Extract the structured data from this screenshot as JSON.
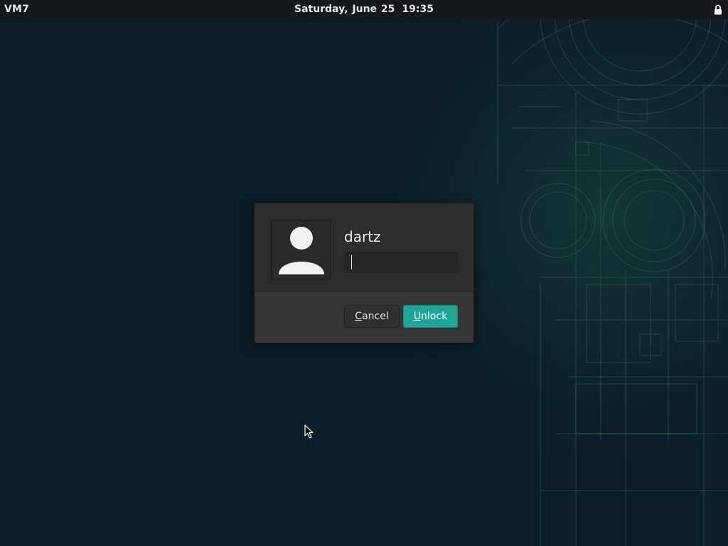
{
  "topbar": {
    "hostname": "VM7",
    "date": "Saturday, June 25",
    "time": "19:35",
    "status_icon": "lock-icon"
  },
  "unlock_dialog": {
    "username": "dartz",
    "avatar_icon": "user-avatar-icon",
    "password_value": "",
    "cancel_button": {
      "mnemonic": "C",
      "rest": "ancel"
    },
    "unlock_button": {
      "mnemonic": "U",
      "rest": "nlock"
    }
  },
  "colors": {
    "background": "#0b1d2a",
    "topbar": "#15191c",
    "dialog_body": "#353535",
    "dialog_header": "#2d2d2d",
    "accent": "#1ea59a",
    "blueprint_lines": "#2f6b4a"
  },
  "cursor_icon": "arrow-pointer-icon"
}
